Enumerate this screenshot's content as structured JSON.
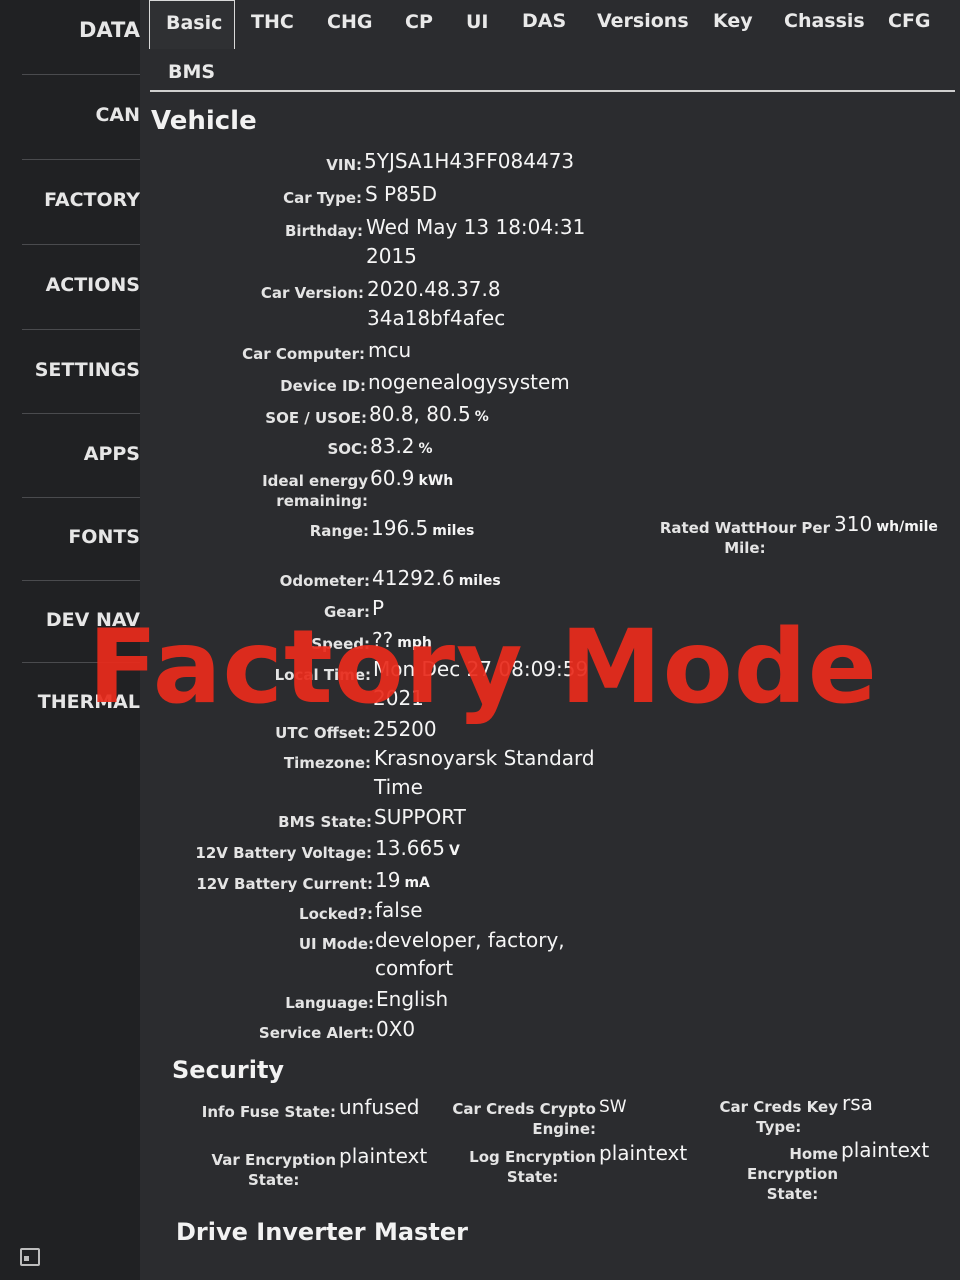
{
  "sidebar": {
    "items": [
      "DATA",
      "CAN",
      "FACTORY",
      "ACTIONS",
      "SETTINGS",
      "APPS",
      "FONTS",
      "DEV NAV",
      "THERMAL"
    ]
  },
  "tabs": [
    "Basic",
    "THC",
    "CHG",
    "CP",
    "UI",
    "DAS",
    "Versions",
    "Key",
    "Chassis",
    "CFG",
    "BMS"
  ],
  "active_tab": "Basic",
  "vehicle": {
    "title": "Vehicle",
    "vin_label": "VIN:",
    "vin": "5YJSA1H43FF084473",
    "car_type_label": "Car Type:",
    "car_type": "S P85D",
    "birthday_label": "Birthday:",
    "birthday_1": "Wed May 13 18:04:31",
    "birthday_2": "2015",
    "car_version_label": "Car Version:",
    "car_version_1": "2020.48.37.8",
    "car_version_2": "34a18bf4afec",
    "car_computer_label": "Car Computer:",
    "car_computer": "mcu",
    "device_id_label": "Device ID:",
    "device_id": "nogenealogysystem",
    "soe_label": "SOE / USOE:",
    "soe": "80.8, 80.5",
    "soe_unit": "%",
    "soc_label": "SOC:",
    "soc": "83.2",
    "soc_unit": "%",
    "ideal_energy_label_1": "Ideal energy",
    "ideal_energy_label_2": "remaining:",
    "ideal_energy": "60.9",
    "ideal_energy_unit": "kWh",
    "range_label": "Range:",
    "range": "196.5",
    "range_unit": "miles",
    "rated_wh_label_1": "Rated WattHour Per",
    "rated_wh_label_2": "Mile:",
    "rated_wh": "310",
    "rated_wh_unit": "wh/mile",
    "odometer_label": "Odometer:",
    "odometer": "41292.6",
    "odometer_unit": "miles",
    "gear_label": "Gear:",
    "gear": "P",
    "speed_label": "Speed:",
    "speed": "??",
    "speed_unit": "mph",
    "local_time_label": "Local Time:",
    "local_time_1": "Mon Dec 27 08:09:59",
    "local_time_2": "2021",
    "utc_offset_label": "UTC Offset:",
    "utc_offset": "25200",
    "timezone_label": "Timezone:",
    "timezone_1": "Krasnoyarsk Standard",
    "timezone_2": "Time",
    "bms_state_label": "BMS State:",
    "bms_state": "SUPPORT",
    "battery_voltage_label": "12V Battery Voltage:",
    "battery_voltage": "13.665",
    "battery_voltage_unit": "V",
    "battery_current_label": "12V Battery Current:",
    "battery_current": "19",
    "battery_current_unit": "mA",
    "locked_label": "Locked?:",
    "locked": "false",
    "ui_mode_label": "UI Mode:",
    "ui_mode_1": "developer, factory,",
    "ui_mode_2": "comfort",
    "language_label": "Language:",
    "language": "English",
    "service_alert_label": "Service Alert:",
    "service_alert": "0X0"
  },
  "security": {
    "title": "Security",
    "info_fuse_label": "Info Fuse State:",
    "info_fuse": "unfused",
    "crypto_engine_label_1": "Car Creds Crypto",
    "crypto_engine_label_2": "Engine:",
    "crypto_engine": "SW",
    "key_type_label_1": "Car Creds Key",
    "key_type_label_2": "Type:",
    "key_type": "rsa",
    "var_enc_label_1": "Var Encryption",
    "var_enc_label_2": "State:",
    "var_enc": "plaintext",
    "log_enc_label_1": "Log Encryption",
    "log_enc_label_2": "State:",
    "log_enc": "plaintext",
    "home_enc_label_1": "Home",
    "home_enc_label_2": "Encryption",
    "home_enc_label_3": "State:",
    "home_enc": "plaintext"
  },
  "drive_inverter": {
    "title": "Drive Inverter Master"
  },
  "watermark": "Factory Mode",
  "colors": {
    "watermark": "#e82b1c",
    "background": "#2b2c2f",
    "sidebar": "#202123"
  }
}
